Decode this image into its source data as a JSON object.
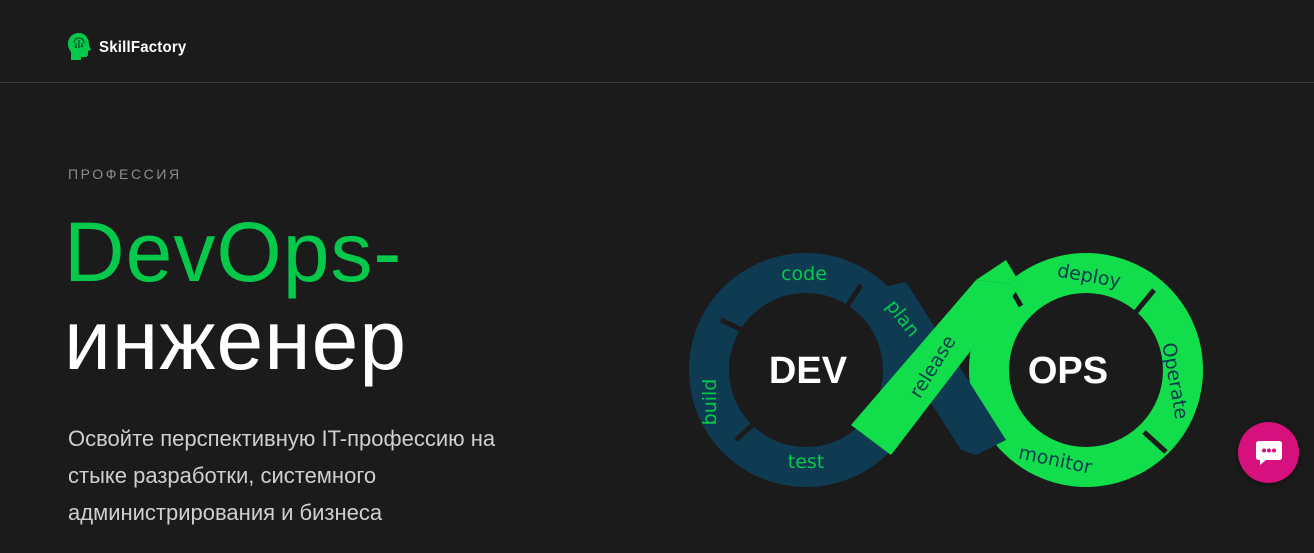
{
  "header": {
    "logo_text": "SkillFactory"
  },
  "hero": {
    "eyebrow": "ПРОФЕССИЯ",
    "title_accent": "DevOps-",
    "title_main": "инженер",
    "subtitle": "Освойте перспективную IT-профессию на стыке разработки, системного администрирования и бизнеса"
  },
  "diagram": {
    "dev_label": "DEV",
    "ops_label": "OPS",
    "stages": {
      "code": "code",
      "build": "build",
      "test": "test",
      "plan": "plan",
      "release": "release",
      "deploy": "deploy",
      "operate": "Operate",
      "monitor": "monitor"
    },
    "colors": {
      "dev_loop": "#0e3a52",
      "ops_loop": "#12dd4b",
      "dev_text": "#05c94a",
      "ops_text": "#0e3a52"
    }
  },
  "colors": {
    "background": "#1b1b1b",
    "accent": "#05c94a",
    "chat_button": "#d6107c"
  },
  "icons": {
    "logo": "brain-head-icon",
    "chat": "chat-bubble-icon"
  }
}
